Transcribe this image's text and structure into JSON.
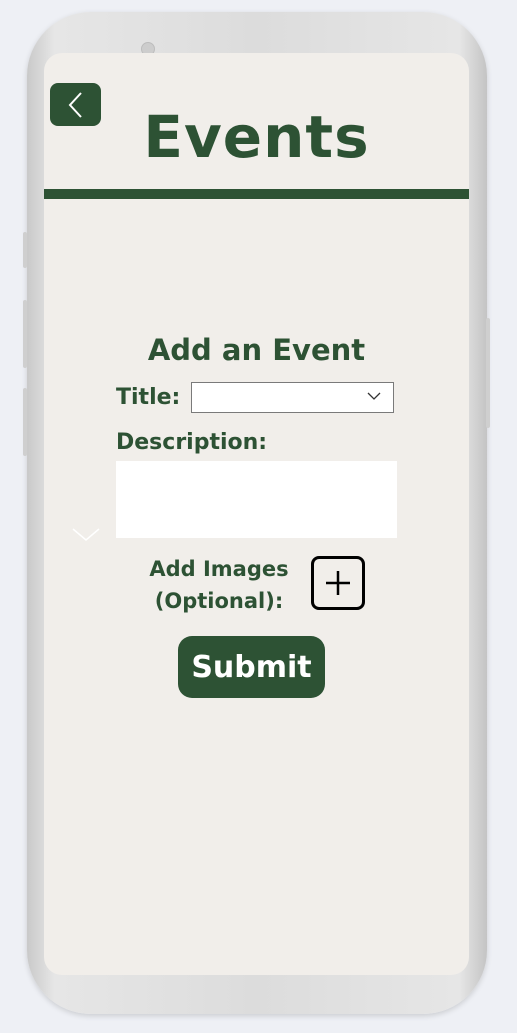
{
  "header": {
    "title": "Events"
  },
  "form": {
    "heading": "Add an Event",
    "title_label": "Title:",
    "title_value": "",
    "description_label": "Description:",
    "description_value": "",
    "images_label_line1": "Add Images",
    "images_label_line2": "(Optional):",
    "submit_label": "Submit"
  },
  "icons": {
    "back": "chevron-left-icon",
    "dropdown": "chevron-down-icon",
    "scroll": "chevron-down-icon",
    "add_image": "plus-icon"
  },
  "colors": {
    "primary": "#2d5234",
    "screen_bg": "#f1eeea",
    "page_bg": "#eef0f5"
  }
}
